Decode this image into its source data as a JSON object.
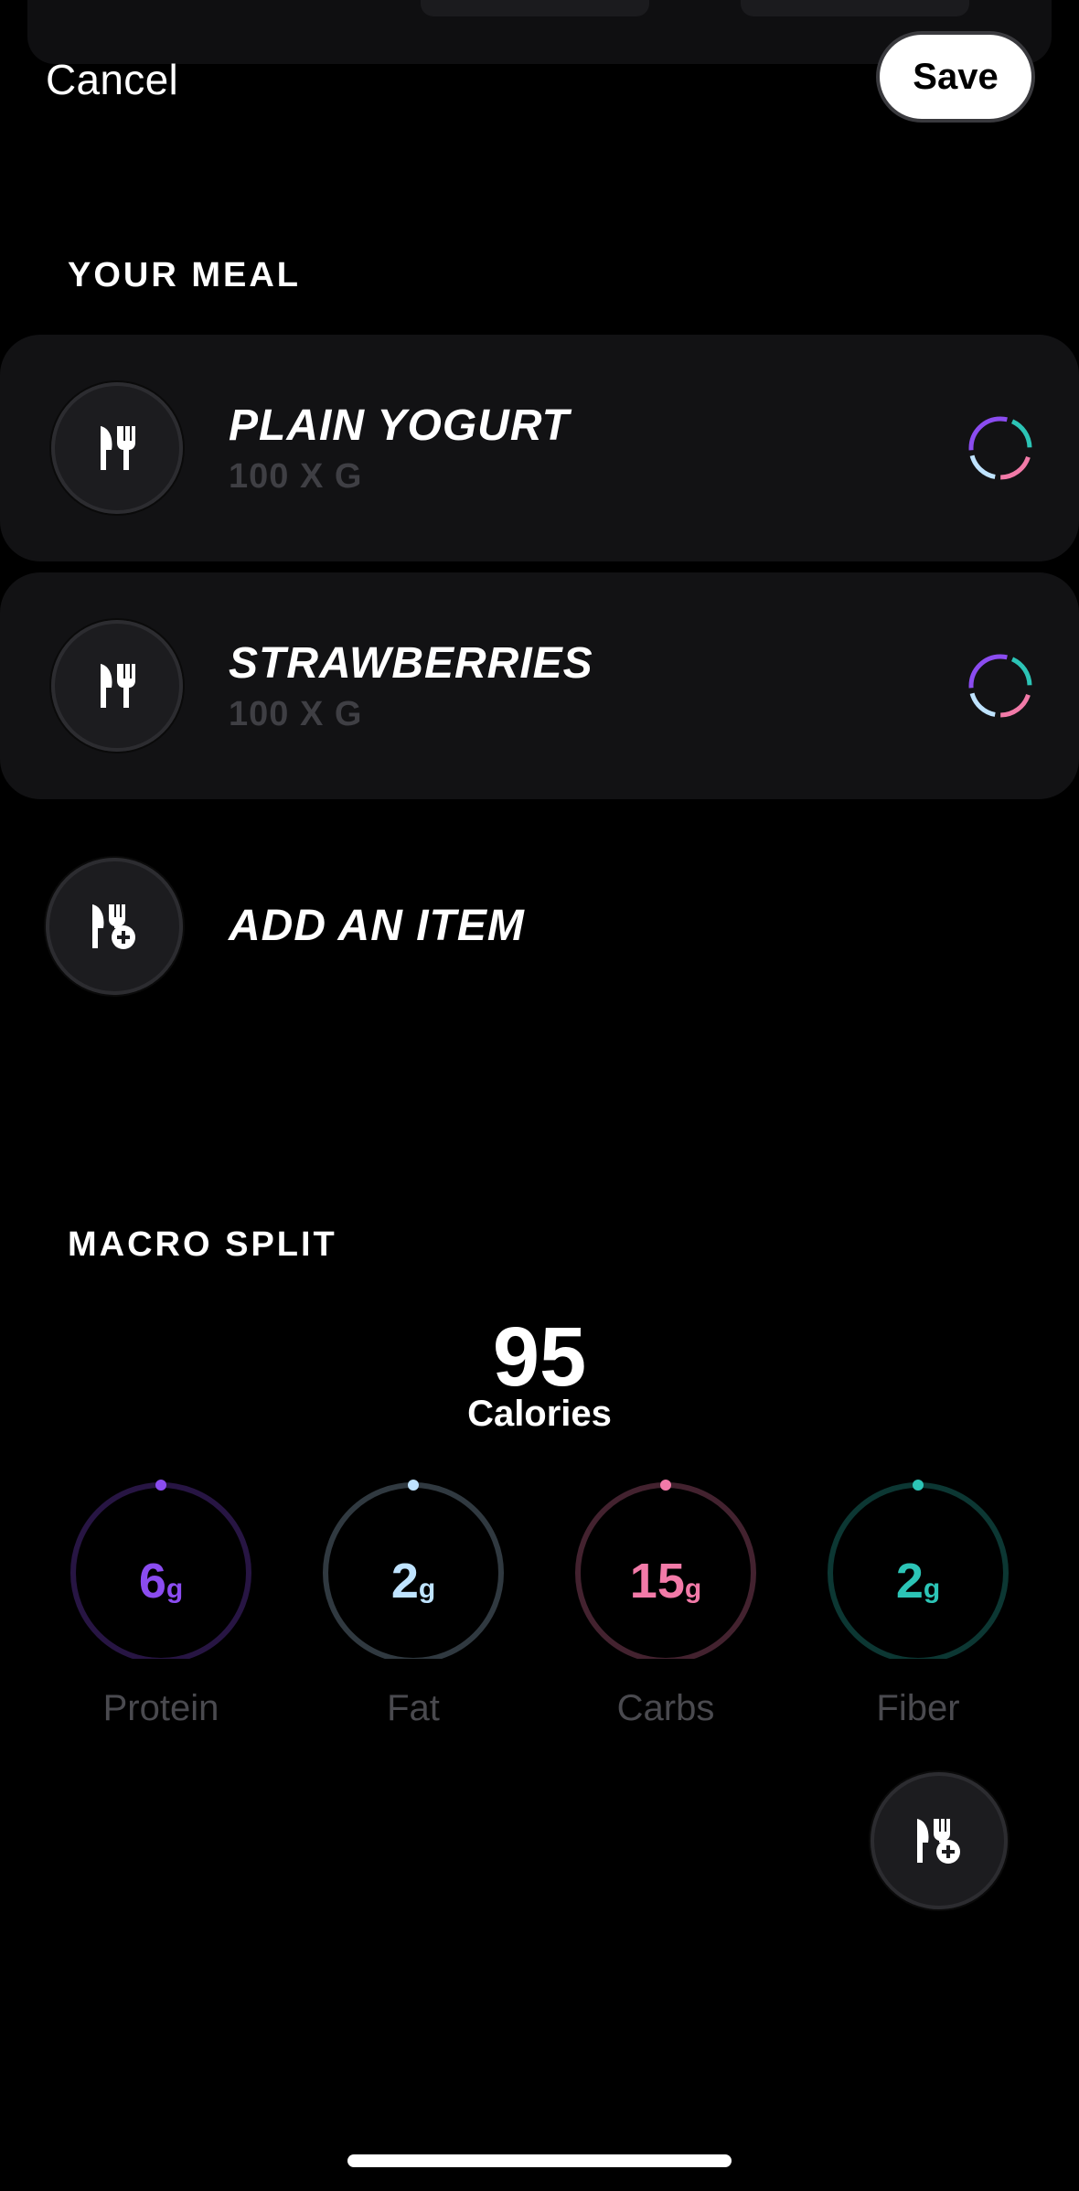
{
  "header": {
    "cancel_label": "Cancel",
    "save_label": "Save"
  },
  "meal": {
    "section_title": "YOUR MEAL",
    "items": [
      {
        "name": "PLAIN YOGURT",
        "quantity": "100 X G"
      },
      {
        "name": "STRAWBERRIES",
        "quantity": "100 X G"
      }
    ],
    "add_item_label": "ADD AN ITEM"
  },
  "macros": {
    "section_title": "MACRO SPLIT",
    "calories_value": "95",
    "calories_label": "Calories",
    "items": [
      {
        "value": "6",
        "unit": "g",
        "label": "Protein",
        "color": "#8b4cf0"
      },
      {
        "value": "2",
        "unit": "g",
        "label": "Fat",
        "color": "#bfe3ff"
      },
      {
        "value": "15",
        "unit": "g",
        "label": "Carbs",
        "color": "#f27aa8"
      },
      {
        "value": "2",
        "unit": "g",
        "label": "Fiber",
        "color": "#2cc4b6"
      }
    ]
  },
  "colors": {
    "background": "#000000",
    "card": "#121214",
    "muted_text": "#4a4a4f"
  },
  "icons": {
    "meal_item": "knife-fork-icon",
    "add_item": "knife-fork-plus-icon",
    "item_status": "macro-ring-icon"
  }
}
